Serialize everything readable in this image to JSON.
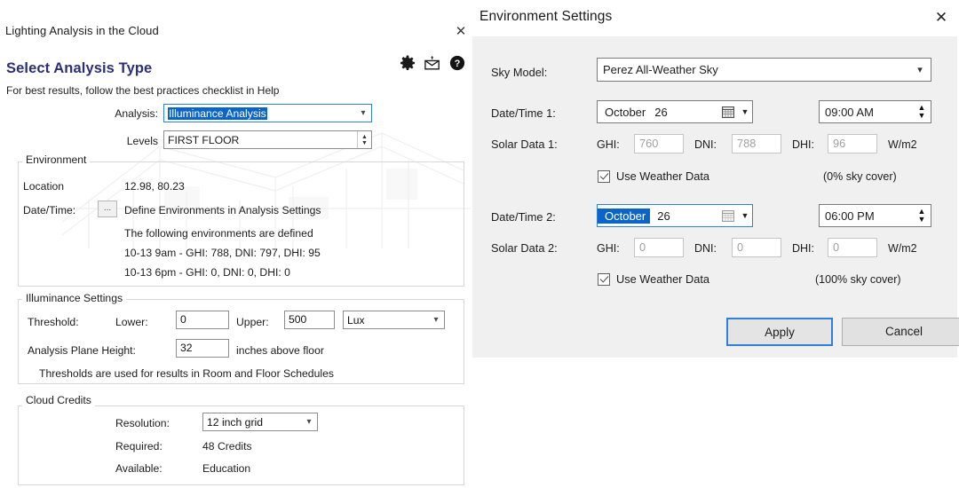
{
  "left_panel": {
    "window_title": "Lighting Analysis in the Cloud",
    "close_icon": "close-icon",
    "heading": "Select Analysis Type",
    "subheading": "For best results, follow the best practices checklist in Help",
    "toolbar": {
      "settings_icon": "gear-icon",
      "mail_icon": "envelope-upload-icon",
      "help_icon": "help-circle-icon"
    },
    "analysis": {
      "label": "Analysis:",
      "value": "Illuminance Analysis"
    },
    "levels": {
      "label": "Levels",
      "value": "FIRST FLOOR"
    },
    "environment": {
      "group_label": "Environment",
      "location_label": "Location",
      "location_value": "12.98, 80.23",
      "datetime_label": "Date/Time:",
      "ellipsis_button": "...",
      "define_link": "Define Environments in Analysis Settings",
      "defined_note": "The following environments are defined",
      "env_line_1": "10-13 9am - GHI: 788, DNI: 797, DHI: 95",
      "env_line_2": "10-13 6pm - GHI: 0, DNI: 0, DHI: 0"
    },
    "illuminance_settings": {
      "group_label": "Illuminance Settings",
      "threshold_label": "Threshold:",
      "lower_label": "Lower:",
      "lower_value": "0",
      "upper_label": "Upper:",
      "upper_value": "500",
      "unit_value": "Lux",
      "plane_height_label": "Analysis Plane Height:",
      "plane_height_value": "32",
      "plane_height_suffix": "inches above floor",
      "note": "Thresholds are used for results in Room and Floor Schedules"
    },
    "cloud_credits": {
      "group_label": "Cloud Credits",
      "resolution_label": "Resolution:",
      "resolution_value": "12 inch grid",
      "required_label": "Required:",
      "required_value": "48 Credits",
      "available_label": "Available:",
      "available_value": "Education"
    }
  },
  "env_dialog": {
    "title": "Environment Settings",
    "close_icon": "close-icon",
    "sky_model": {
      "label": "Sky Model:",
      "value": "Perez All-Weather Sky"
    },
    "datetime_1": {
      "label": "Date/Time 1:",
      "month": "October",
      "day": "26",
      "calendar_icon": "calendar-icon",
      "time": "09:00 AM"
    },
    "solar_1": {
      "label": "Solar Data 1:",
      "ghi_label": "GHI:",
      "ghi_value": "760",
      "dni_label": "DNI:",
      "dni_value": "788",
      "dhi_label": "DHI:",
      "dhi_value": "96",
      "units": "W/m2",
      "use_weather_label": "Use Weather Data",
      "sky_cover": "(0% sky cover)"
    },
    "datetime_2": {
      "label": "Date/Time 2:",
      "month": "October",
      "day": "26",
      "calendar_icon": "calendar-icon",
      "time": "06:00 PM"
    },
    "solar_2": {
      "label": "Solar Data 2:",
      "ghi_label": "GHI:",
      "ghi_value": "0",
      "dni_label": "DNI:",
      "dni_value": "0",
      "dhi_label": "DHI:",
      "dhi_value": "0",
      "units": "W/m2",
      "use_weather_label": "Use Weather Data",
      "sky_cover": "(100% sky cover)"
    },
    "apply_label": "Apply",
    "cancel_label": "Cancel"
  },
  "colors": {
    "heading": "#2c2f78",
    "selection": "#0b65c8",
    "dialog_bg": "#f0f0f0",
    "focus_border": "#2f80d8"
  }
}
